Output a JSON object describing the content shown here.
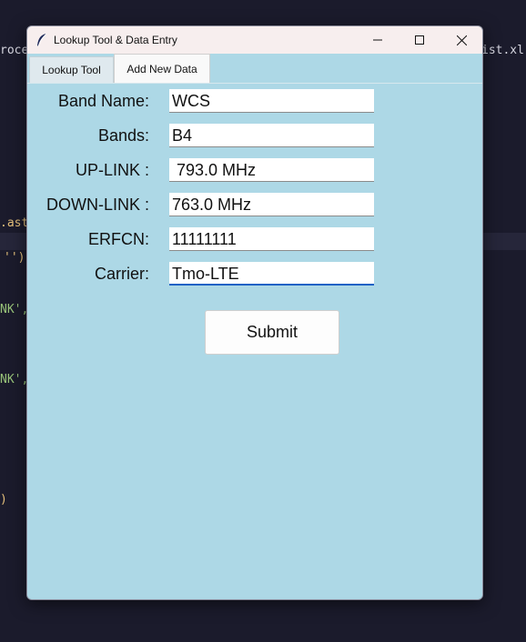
{
  "window": {
    "title": "Lookup Tool & Data Entry",
    "icon": "feather-icon",
    "controls": [
      "minimize-icon",
      "maximize-icon",
      "close-icon"
    ]
  },
  "tabs": [
    {
      "label": "Lookup Tool",
      "selected": false
    },
    {
      "label": "Add New Data",
      "selected": true
    }
  ],
  "form": {
    "fields": [
      {
        "label": "Band Name:",
        "value": "WCS"
      },
      {
        "label": "Bands:",
        "value": "B4"
      },
      {
        "label": "UP-LINK :",
        "value": " 793.0 MHz"
      },
      {
        "label": "DOWN-LINK :",
        "value": "763.0 MHz"
      },
      {
        "label": "ERFCN:",
        "value": "11111111"
      },
      {
        "label": "Carrier:",
        "value": "Tmo-LTE"
      }
    ],
    "submit_label": "Submit"
  },
  "background_editor": {
    "fragments": [
      "roce",
      "ist.xl",
      ".ast",
      "'')",
      "NK',",
      "NK',",
      ")"
    ]
  }
}
